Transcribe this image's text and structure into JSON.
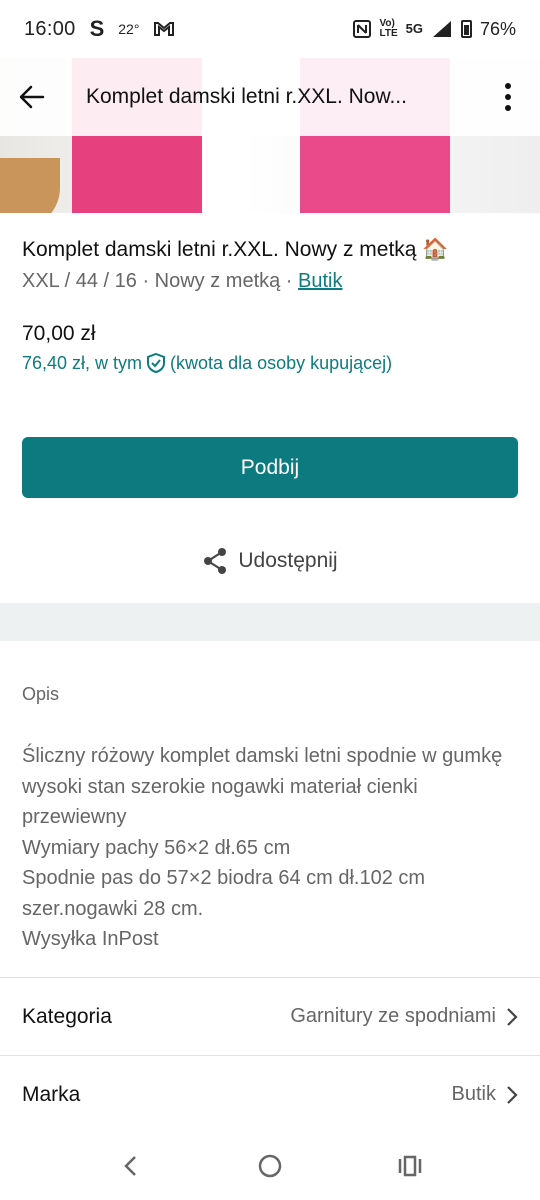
{
  "status_bar": {
    "time": "16:00",
    "app_letter": "S",
    "temperature": "22°",
    "network_small_top": "Vo)",
    "network_small_bottom": "LTE",
    "network_5g": "5G",
    "battery": "76%"
  },
  "toolbar": {
    "title": "Komplet damski letni r.XXL. Now..."
  },
  "item": {
    "title": "Komplet damski letni r.XXL. Nowy z metką 🏠",
    "meta": "XXL / 44 / 16 · Nowy z metką · ",
    "brand": "Butik",
    "price": "70,00 zł",
    "buyer_price": "76,40 zł, w tym",
    "buyer_price_note": "(kwota dla osoby kupującej)"
  },
  "actions": {
    "bump_label": "Podbij",
    "share_label": "Udostępnij"
  },
  "description": {
    "label": "Opis",
    "text": "Śliczny różowy komplet damski letni spodnie w gumkę wysoki stan szerokie nogawki materiał cienki przewiewny\nWymiary pachy 56×2 dł.65 cm\nSpodnie pas do 57×2 biodra 64 cm dł.102 cm szer.nogawki 28 cm.\nWysyłka InPost"
  },
  "details": [
    {
      "label": "Kategoria",
      "value": "Garnitury ze spodniami"
    },
    {
      "label": "Marka",
      "value": "Butik"
    }
  ],
  "colors": {
    "accent": "#0d7a7f",
    "link": "#0e7c80"
  }
}
